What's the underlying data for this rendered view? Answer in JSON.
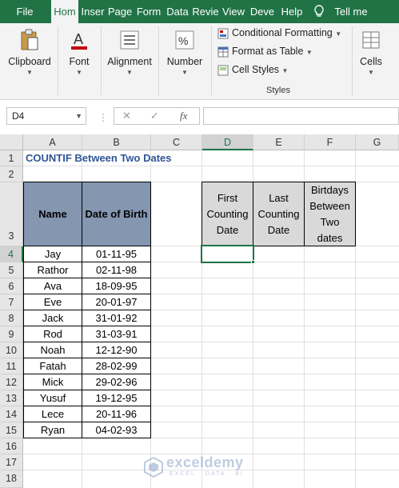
{
  "ribbon_tabs": [
    {
      "label": "File",
      "active": false
    },
    {
      "label": "Hom",
      "active": true
    },
    {
      "label": "Inser",
      "active": false
    },
    {
      "label": "Page",
      "active": false
    },
    {
      "label": "Form",
      "active": false
    },
    {
      "label": "Data",
      "active": false
    },
    {
      "label": "Revie",
      "active": false
    },
    {
      "label": "View",
      "active": false
    },
    {
      "label": "Deve",
      "active": false
    },
    {
      "label": "Help",
      "active": false
    }
  ],
  "tell_me": "Tell me",
  "ribbon": {
    "clipboard": "Clipboard",
    "font": "Font",
    "alignment": "Alignment",
    "number": "Number",
    "conditional_formatting": "Conditional Formatting",
    "format_as_table": "Format as Table",
    "cell_styles": "Cell Styles",
    "styles_caption": "Styles",
    "cells": "Cells",
    "number_symbol": "%"
  },
  "formula_bar": {
    "name_box": "D4",
    "formula": ""
  },
  "columns": [
    "A",
    "B",
    "C",
    "D",
    "E",
    "F",
    "G"
  ],
  "selected_column": "D",
  "rows": [
    "1",
    "2",
    "3",
    "4",
    "5",
    "6",
    "7",
    "8",
    "9",
    "10",
    "11",
    "12",
    "13",
    "14",
    "15",
    "16",
    "17",
    "18"
  ],
  "selected_row": "4",
  "sheet": {
    "title": "COUNTIF Between Two Dates",
    "table_headers": [
      "Name",
      "Date of Birth"
    ],
    "table_rows": [
      [
        "Jay",
        "01-11-95"
      ],
      [
        "Rathor",
        "02-11-98"
      ],
      [
        "Ava",
        "18-09-95"
      ],
      [
        "Eve",
        "20-01-97"
      ],
      [
        "Jack",
        "31-01-92"
      ],
      [
        "Rod",
        "31-03-91"
      ],
      [
        "Noah",
        "12-12-90"
      ],
      [
        "Fatah",
        "28-02-99"
      ],
      [
        "Mick",
        "29-02-96"
      ],
      [
        "Yusuf",
        "19-12-95"
      ],
      [
        "Lece",
        "20-11-96"
      ],
      [
        "Ryan",
        "04-02-93"
      ]
    ],
    "criteria_headers": [
      [
        "First",
        "Counting",
        "Date"
      ],
      [
        "Last",
        "Counting",
        "Date"
      ],
      [
        "Birtdays",
        "Between",
        "Two",
        "dates"
      ]
    ]
  },
  "watermark": {
    "name": "exceldemy",
    "tagline": "EXCEL · DATA · BI"
  },
  "colors": {
    "excel_green": "#217346",
    "header_fill": "#8496b0",
    "criteria_fill": "#d9d9d9",
    "title_blue": "#2f5597"
  }
}
